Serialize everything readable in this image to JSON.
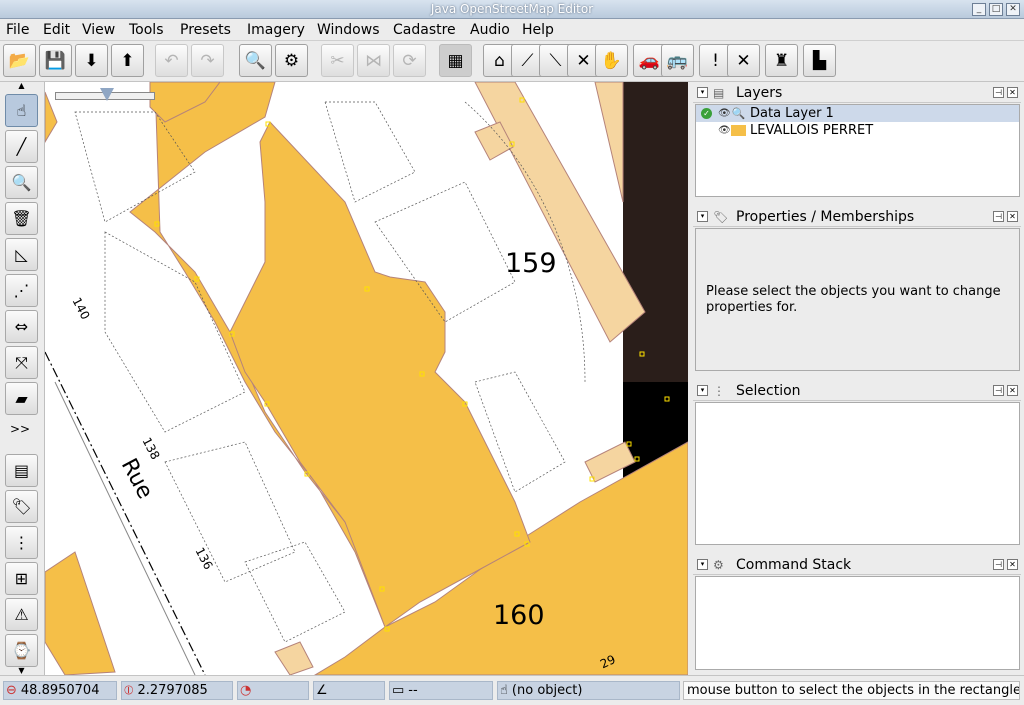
{
  "window": {
    "title": "Java OpenStreetMap Editor"
  },
  "menu": [
    "File",
    "Edit",
    "View",
    "Tools",
    "Presets",
    "Imagery",
    "Windows",
    "Cadastre",
    "Audio",
    "Help"
  ],
  "map": {
    "labels": [
      "159",
      "160",
      "140",
      "138",
      "136",
      "29",
      "Rue"
    ]
  },
  "panels": {
    "layers": {
      "title": "Layers",
      "items": [
        {
          "name": "Data Layer 1",
          "active": true,
          "icon": "data-layer-icon"
        },
        {
          "name": "LEVALLOIS PERRET",
          "active": false,
          "icon": "cadastre-layer-icon"
        }
      ]
    },
    "properties": {
      "title": "Properties / Memberships",
      "message": "Please select the objects you want to change properties for."
    },
    "selection": {
      "title": "Selection"
    },
    "commands": {
      "title": "Command Stack"
    }
  },
  "status": {
    "lat": "48.8950704",
    "lon": "2.2797085",
    "heading": "",
    "angle": "",
    "distance": "--",
    "object": "(no object)",
    "help": "mouse button to select the objects in the rectangle."
  },
  "colors": {
    "building": "#f5bf48",
    "building_stroke": "#b5837a",
    "road": "#f5d5a0",
    "map_bg": "#ffffff"
  }
}
